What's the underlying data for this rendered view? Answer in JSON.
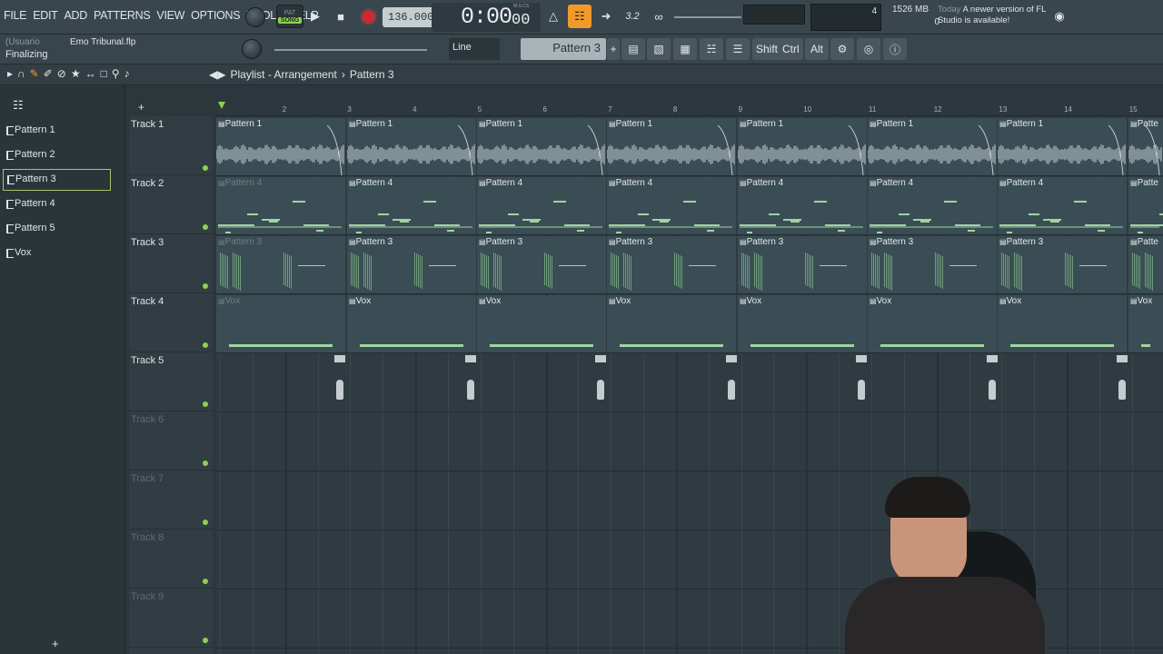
{
  "menu": [
    "FILE",
    "EDIT",
    "ADD",
    "PATTERNS",
    "VIEW",
    "OPTIONS",
    "TOOLS",
    "HELP"
  ],
  "transport": {
    "pat_label": "PAT",
    "song_label": "SONG",
    "tempo": "136.000",
    "time": "0:00",
    "time_small": "00",
    "time_unit": "M:S:CS"
  },
  "status": {
    "cpu_value": "4",
    "memory": "1526 MB",
    "polyphony": "0"
  },
  "news": {
    "day": "Today",
    "message": "A newer version of FL Studio is available!"
  },
  "project": {
    "user": "(Usuario",
    "file": "Emo Tribunal.flp",
    "status_text": "Finalizing"
  },
  "toolbar2": {
    "snap": "Line",
    "pattern": "Pattern 3",
    "shift": "Shift",
    "ctrl": "Ctrl",
    "alt": "Alt"
  },
  "playlist": {
    "title": "Playlist - Arrangement",
    "pattern": "Pattern 3",
    "separator": "›"
  },
  "picker": [
    {
      "label": "Pattern 1",
      "selected": false
    },
    {
      "label": "Pattern 2",
      "selected": false
    },
    {
      "label": "Pattern 3",
      "selected": true
    },
    {
      "label": "Pattern 4",
      "selected": false
    },
    {
      "label": "Pattern 5",
      "selected": false
    },
    {
      "label": "Vox",
      "selected": false
    }
  ],
  "tracks": [
    "Track 1",
    "Track 2",
    "Track 3",
    "Track 4",
    "Track 5",
    "Track 6",
    "Track 7",
    "Track 8",
    "Track 9"
  ],
  "ruler": [
    "2",
    "3",
    "4",
    "5",
    "6",
    "7",
    "8",
    "9",
    "10",
    "11",
    "12",
    "13",
    "14",
    "15"
  ],
  "clips": {
    "track1": [
      "Pattern 1",
      "Pattern 1",
      "Pattern 1",
      "Pattern 1",
      "Pattern 1",
      "Pattern 1",
      "Pattern 1",
      "Patte"
    ],
    "track2": [
      "Pattern 4",
      "Pattern 4",
      "Pattern 4",
      "Pattern 4",
      "Pattern 4",
      "Pattern 4",
      "Pattern 4",
      "Patte"
    ],
    "track3": [
      "Pattern 3",
      "Pattern 3",
      "Pattern 3",
      "Pattern 3",
      "Pattern 3",
      "Pattern 3",
      "Pattern 3",
      "Patte"
    ],
    "track4": [
      "Vox",
      "Vox",
      "Vox",
      "Vox",
      "Vox",
      "Vox",
      "Vox",
      "Vox"
    ]
  },
  "colors": {
    "accent_orange": "#f19a2b",
    "song_green": "#8fd14f",
    "record_red": "#d2262c",
    "note_green": "#9fd4a1"
  }
}
